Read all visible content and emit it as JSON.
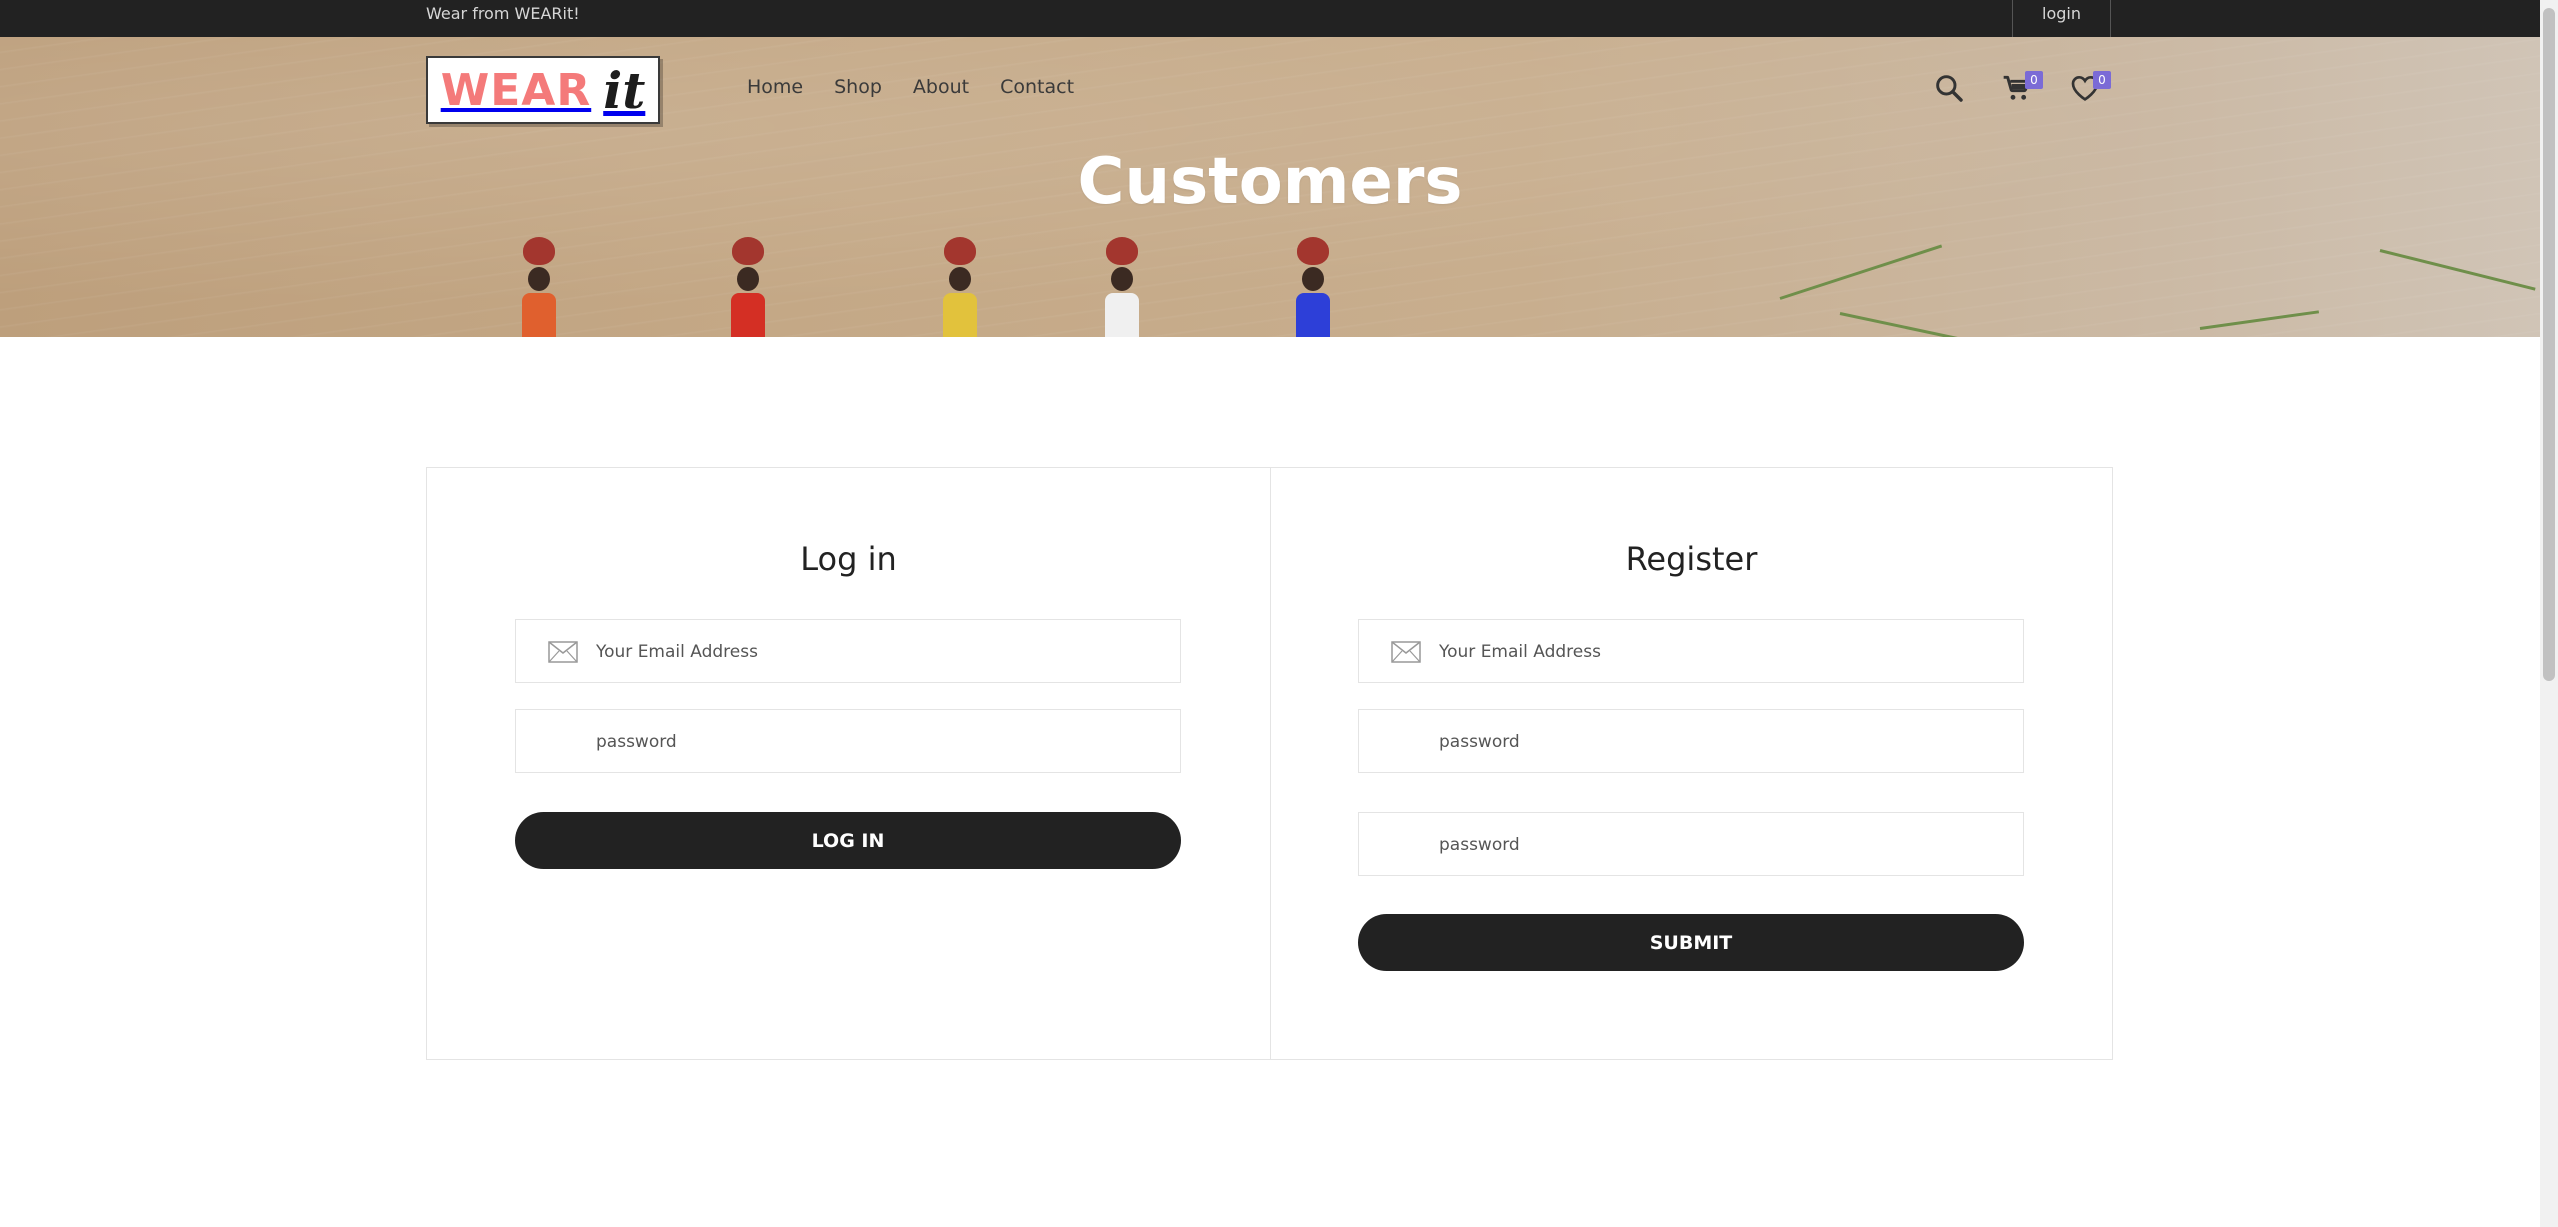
{
  "topbar": {
    "tagline": "Wear from WEARit!",
    "login_label": "login"
  },
  "logo": {
    "word": "WEAR",
    "accent": "it",
    "colors": {
      "word": "#f47a7a",
      "accent": "#1d1d1d"
    }
  },
  "nav": {
    "items": [
      {
        "label": "Home"
      },
      {
        "label": "Shop"
      },
      {
        "label": "About"
      },
      {
        "label": "Contact"
      }
    ]
  },
  "header_icons": {
    "search": "search-icon",
    "cart": {
      "icon": "cart-icon",
      "count": "0"
    },
    "wishlist": {
      "icon": "heart-icon",
      "count": "0"
    }
  },
  "hero": {
    "title": "Customers"
  },
  "login_form": {
    "title": "Log in",
    "email_placeholder": "Your Email Address",
    "password_placeholder": "password",
    "button_label": "LOG IN"
  },
  "register_form": {
    "title": "Register",
    "email_placeholder": "Your Email Address",
    "password_placeholder": "password",
    "confirm_password_placeholder": "password",
    "button_label": "SUBMIT"
  },
  "colors": {
    "dark": "#222222",
    "badge": "#7b6bd6",
    "border": "#e4e4e4"
  }
}
